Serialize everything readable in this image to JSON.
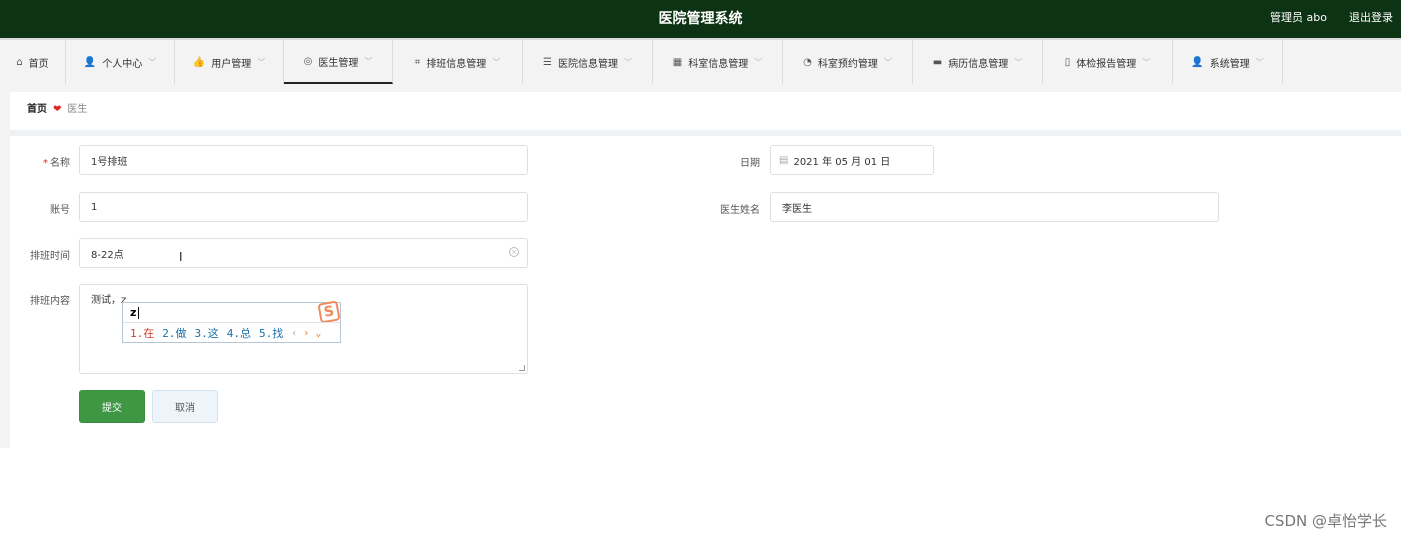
{
  "header": {
    "title": "医院管理系统",
    "user": "管理员 abo",
    "logout": "退出登录",
    "bg_color": "#0c3313"
  },
  "nav": [
    {
      "label": "首页",
      "icon": "home-icon",
      "glyph": "⌂"
    },
    {
      "label": "个人中心",
      "icon": "person-icon",
      "glyph": "👤"
    },
    {
      "label": "用户管理",
      "icon": "thumb-icon",
      "glyph": "👍"
    },
    {
      "label": "医生管理",
      "icon": "target-icon",
      "glyph": "◎"
    },
    {
      "label": "排班信息管理",
      "icon": "crop-icon",
      "glyph": "⌗"
    },
    {
      "label": "医院信息管理",
      "icon": "sliders-icon",
      "glyph": "☰"
    },
    {
      "label": "科室信息管理",
      "icon": "grid-icon",
      "glyph": "▦"
    },
    {
      "label": "科室预约管理",
      "icon": "gauge-icon",
      "glyph": "◔"
    },
    {
      "label": "病历信息管理",
      "icon": "ticket-icon",
      "glyph": "▬"
    },
    {
      "label": "体检报告管理",
      "icon": "phone-icon",
      "glyph": "▯"
    },
    {
      "label": "系统管理",
      "icon": "person-icon",
      "glyph": "👤"
    }
  ],
  "breadcrumb": {
    "home": "首页",
    "current": "医生"
  },
  "form": {
    "name_label": "名称",
    "name_value": "1号排班",
    "date_label": "日期",
    "date_value": "2021 年 05 月 01 日",
    "account_label": "账号",
    "account_value": "1",
    "doctor_label": "医生姓名",
    "doctor_value": "李医生",
    "time_label": "排班时间",
    "time_value": "8-22点",
    "content_label": "排班内容",
    "content_value": "测试，z"
  },
  "ime": {
    "composition": "z",
    "candidates": [
      "1.在",
      "2.做",
      "3.这",
      "4.总",
      "5.找"
    ],
    "logo": "S"
  },
  "buttons": {
    "submit": "提交",
    "cancel": "取消",
    "primary_color": "#3f9744"
  },
  "watermark": "CSDN @卓怡学长"
}
